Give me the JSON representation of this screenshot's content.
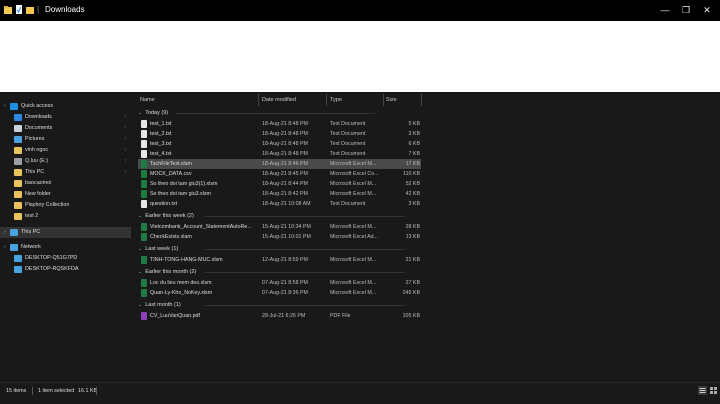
{
  "window": {
    "title": "Downloads",
    "minimize_glyph": "—",
    "maximize_glyph": "❐",
    "close_glyph": "✕",
    "qat_separator": "|"
  },
  "navigation": [
    {
      "label": "Quick access",
      "icon": "star-icon",
      "color": "#1e8fe0",
      "pinned": false,
      "chevron": "›"
    },
    {
      "label": "Downloads",
      "icon": "download-icon",
      "color": "#2d89e5",
      "pinned": true
    },
    {
      "label": "Documents",
      "icon": "documents-icon",
      "color": "#c7d2dc",
      "pinned": true
    },
    {
      "label": "Pictures",
      "icon": "pictures-icon",
      "color": "#4aa3df",
      "pinned": true
    },
    {
      "label": "vinh ngoc",
      "icon": "folder-icon",
      "color": "#e8c25a",
      "pinned": true
    },
    {
      "label": "Q.luu (E:)",
      "icon": "drive-icon",
      "color": "#9aa0a6",
      "pinned": true
    },
    {
      "label": "This PC",
      "icon": "folder-icon",
      "color": "#e8c25a",
      "pinned": true
    },
    {
      "label": "baocaomoi",
      "icon": "folder-icon",
      "color": "#e8c25a",
      "pinned": false
    },
    {
      "label": "New folder",
      "icon": "folder-icon",
      "color": "#e8c25a",
      "pinned": false
    },
    {
      "label": "Playboy Collection",
      "icon": "folder-icon",
      "color": "#e8c25a",
      "pinned": false
    },
    {
      "label": "test 2",
      "icon": "folder-icon",
      "color": "#e8c25a",
      "pinned": false
    },
    {
      "label": "This PC",
      "icon": "computer-icon",
      "color": "#4aa3df",
      "pinned": false,
      "selected": true,
      "chevron": "›"
    },
    {
      "label": "Network",
      "icon": "network-icon",
      "color": "#4aa3df",
      "pinned": false,
      "chevron": "›"
    },
    {
      "label": "DESKTOP-Q51G7PD",
      "icon": "computer-icon",
      "color": "#4aa3df",
      "pinned": false
    },
    {
      "label": "DESKTOP-RQSKFDA",
      "icon": "computer-icon",
      "color": "#4aa3df",
      "pinned": false
    }
  ],
  "columns": {
    "name": "Name",
    "date": "Date modified",
    "type": "Type",
    "size": "Size"
  },
  "groups": [
    {
      "label": "Today (9)",
      "chevron": "⌄",
      "files": [
        {
          "name": "test_1.txt",
          "date": "18-Aug-21 8:48 PM",
          "type": "Text Document",
          "size": "5 KB",
          "kind": "txt"
        },
        {
          "name": "test_2.txt",
          "date": "18-Aug-21 8:48 PM",
          "type": "Text Document",
          "size": "3 KB",
          "kind": "txt"
        },
        {
          "name": "test_3.txt",
          "date": "18-Aug-21 8:48 PM",
          "type": "Text Document",
          "size": "6 KB",
          "kind": "txt"
        },
        {
          "name": "test_4.txt",
          "date": "18-Aug-21 8:48 PM",
          "type": "Text Document",
          "size": "7 KB",
          "kind": "txt"
        },
        {
          "name": "TachFileText.xlsm",
          "date": "18-Aug-21 8:46 PM",
          "type": "Microsoft Excel M...",
          "size": "17 KB",
          "kind": "excel",
          "selected": true
        },
        {
          "name": "MOCK_DATA.csv",
          "date": "18-Aug-21 8:45 PM",
          "type": "Microsoft Excel Co...",
          "size": "110 KB",
          "kind": "excel"
        },
        {
          "name": "So theo doi tam giu3(1).xlsm",
          "date": "18-Aug-21 8:44 PM",
          "type": "Microsoft Excel M...",
          "size": "52 KB",
          "kind": "excel"
        },
        {
          "name": "So theo doi tam giu3.xlsm",
          "date": "18-Aug-21 8:42 PM",
          "type": "Microsoft Excel M...",
          "size": "42 KB",
          "kind": "excel"
        },
        {
          "name": "question.txt",
          "date": "18-Aug-21 10:08 AM",
          "type": "Text Document",
          "size": "3 KB",
          "kind": "txt"
        }
      ]
    },
    {
      "label": "Earlier this week (2)",
      "chevron": "⌄",
      "files": [
        {
          "name": "Vietcombank_Account_StatementAutoRe...",
          "date": "15-Aug-21 10:34 PM",
          "type": "Microsoft Excel M...",
          "size": "28 KB",
          "kind": "excel"
        },
        {
          "name": "CheckExists.xlam",
          "date": "15-Aug-21 10:01 PM",
          "type": "Microsoft Excel Ad...",
          "size": "13 KB",
          "kind": "excel"
        }
      ]
    },
    {
      "label": "Last week (1)",
      "chevron": "⌄",
      "files": [
        {
          "name": "TINH-TONG-HANG-MUC.xlsm",
          "date": "12-Aug-21 8:59 PM",
          "type": "Microsoft Excel M...",
          "size": "21 KB",
          "kind": "excel"
        }
      ]
    },
    {
      "label": "Earlier this month (2)",
      "chevron": "⌄",
      "files": [
        {
          "name": "Loc du lieu mem deo.xlsm",
          "date": "07-Aug-21 8:58 PM",
          "type": "Microsoft Excel M...",
          "size": "27 KB",
          "kind": "excel"
        },
        {
          "name": "Quan-Ly-Kho_NoKey.xlsm",
          "date": "07-Aug-21 8:36 PM",
          "type": "Microsoft Excel M...",
          "size": "245 KB",
          "kind": "excel"
        }
      ]
    },
    {
      "label": "Last month (1)",
      "chevron": "⌄",
      "files": [
        {
          "name": "CV_LuuVanQuan.pdf",
          "date": "28-Jul-21 6:26 PM",
          "type": "PDF File",
          "size": "105 KB",
          "kind": "pdf"
        }
      ]
    }
  ],
  "status": {
    "items": "15 items",
    "selected": "1 item selected",
    "size": "16.1 KB"
  },
  "colors": {
    "accent": "#2d89e5",
    "excel": "#1f7a44",
    "pdf": "#8b3fb8",
    "txt": "#e6e6e6",
    "selection": "#4a4a4a"
  }
}
